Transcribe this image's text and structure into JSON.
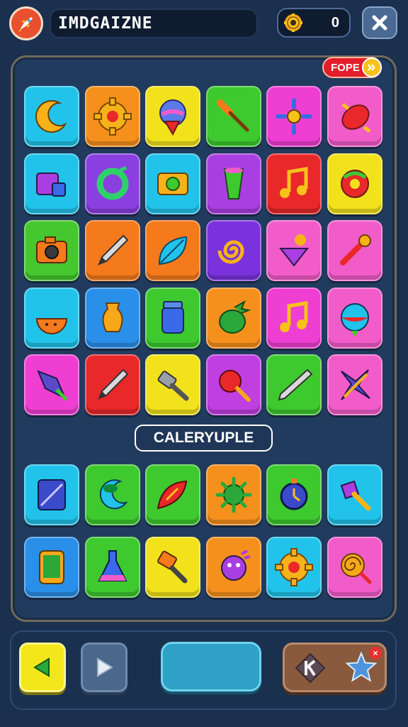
{
  "header": {
    "title": "IMDGAIZNE",
    "coins": "0",
    "logo_icon": "rocket-icon",
    "coin_icon": "gear-coin-icon",
    "close_icon": "close-icon"
  },
  "badge": {
    "label": "FOPE"
  },
  "section_label": "CALERYUPLE",
  "grid_top": [
    {
      "icon": "crescent-icon",
      "color": "#22c3ea"
    },
    {
      "icon": "gear-icon",
      "color": "#f6901c"
    },
    {
      "icon": "ice-cream-icon",
      "color": "#f2e21c"
    },
    {
      "icon": "brush-icon",
      "color": "#3ec92f"
    },
    {
      "icon": "sun-flower-icon",
      "color": "#ee3fd2"
    },
    {
      "icon": "candy-icon",
      "color": "#f25cc9"
    },
    {
      "icon": "box-icon",
      "color": "#22c3ea"
    },
    {
      "icon": "ring-icon",
      "color": "#8a3fe0"
    },
    {
      "icon": "photo-icon",
      "color": "#22c3ea"
    },
    {
      "icon": "cup-icon",
      "color": "#a93fe0"
    },
    {
      "icon": "music-note-icon",
      "color": "#e9282a"
    },
    {
      "icon": "donut-icon",
      "color": "#f2e21c"
    },
    {
      "icon": "camera-icon",
      "color": "#45c72f"
    },
    {
      "icon": "pencil-icon",
      "color": "#f57a1c"
    },
    {
      "icon": "leaf-icon",
      "color": "#f57a1c"
    },
    {
      "icon": "spiral-icon",
      "color": "#7a32dc"
    },
    {
      "icon": "spinning-top-icon",
      "color": "#f25cc9"
    },
    {
      "icon": "wand-icon",
      "color": "#f25cc9"
    },
    {
      "icon": "melon-icon",
      "color": "#22c3ea"
    },
    {
      "icon": "vase-icon",
      "color": "#2a8fe8"
    },
    {
      "icon": "jar-icon",
      "color": "#3ec92f"
    },
    {
      "icon": "strawberry-icon",
      "color": "#f6901c"
    },
    {
      "icon": "music-note-icon",
      "color": "#ee3fd2"
    },
    {
      "icon": "ball-icon",
      "color": "#f25cc9"
    },
    {
      "icon": "kite-icon",
      "color": "#ee3fd2"
    },
    {
      "icon": "pencil-icon",
      "color": "#e9282a"
    },
    {
      "icon": "hammer-icon",
      "color": "#f2e21c"
    },
    {
      "icon": "lollipop-icon",
      "color": "#c03fe0"
    },
    {
      "icon": "knife-icon",
      "color": "#3ec92f"
    },
    {
      "icon": "shuriken-icon",
      "color": "#f25cc9"
    }
  ],
  "grid_bottom": [
    {
      "icon": "tablet-icon",
      "color": "#22c3ea"
    },
    {
      "icon": "moon-icon",
      "color": "#3ec92f"
    },
    {
      "icon": "shell-icon",
      "color": "#3ec92f"
    },
    {
      "icon": "virus-icon",
      "color": "#f6901c"
    },
    {
      "icon": "clock-icon",
      "color": "#3ec92f"
    },
    {
      "icon": "paint-brush-icon",
      "color": "#22c3ea"
    },
    {
      "icon": "phone-icon",
      "color": "#2a8fe8"
    },
    {
      "icon": "flask-icon",
      "color": "#3ec92f"
    },
    {
      "icon": "stamp-icon",
      "color": "#f2e21c"
    },
    {
      "icon": "monster-icon",
      "color": "#f6901c"
    },
    {
      "icon": "gear-icon",
      "color": "#22c3ea"
    },
    {
      "icon": "spiral-lollipop-icon",
      "color": "#f25cc9"
    }
  ],
  "footer": {
    "prev_icon": "arrow-left-icon",
    "next_icon": "arrow-right-icon",
    "tool_icon": "k-gem-icon",
    "star_icon": "star-icon",
    "star_badge": "×"
  }
}
